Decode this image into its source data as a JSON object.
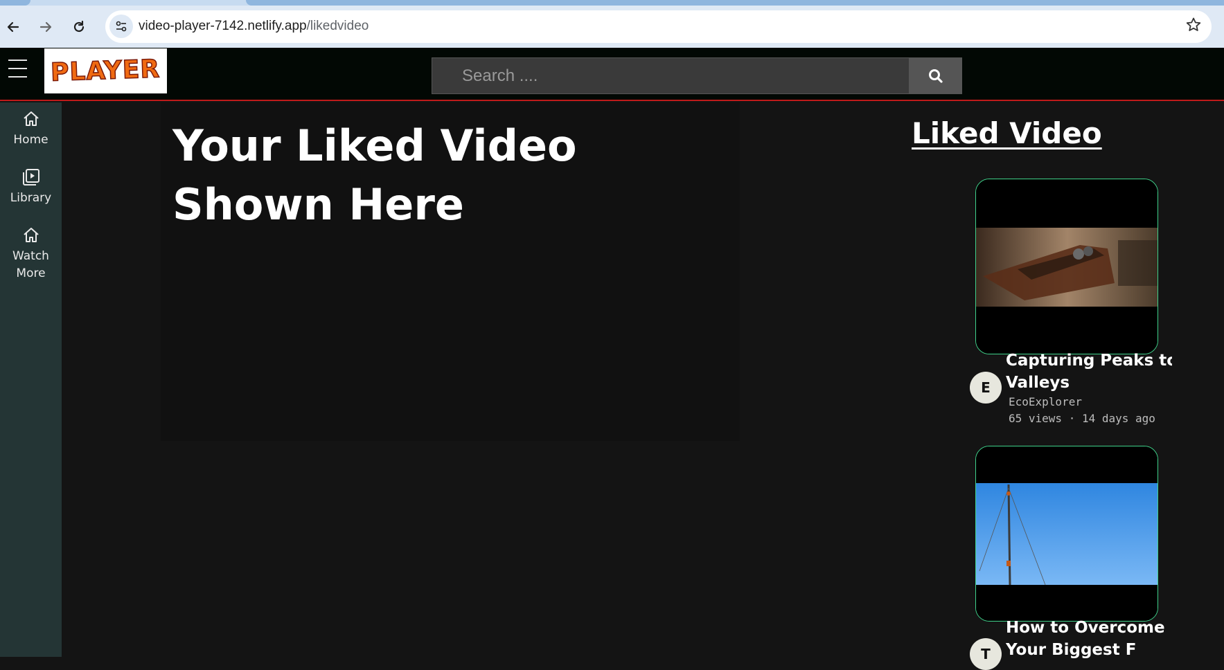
{
  "browser": {
    "url_host": "video-player-7142.netlify.app",
    "url_path": "/likedvideo",
    "back_icon": "arrow-left-icon",
    "forward_icon": "arrow-right-icon",
    "reload_icon": "reload-icon",
    "bookmark_icon": "star-icon"
  },
  "header": {
    "logo_text": "PLAYER",
    "search_placeholder": "Search ....",
    "search_icon": "search-icon"
  },
  "sidebar": {
    "items": [
      {
        "label": "Home",
        "icon": "home-icon"
      },
      {
        "label": "Library",
        "icon": "library-icon"
      },
      {
        "label": "Watch More",
        "icon": "home-icon"
      }
    ]
  },
  "main": {
    "title": "Your Liked Video Shown Here"
  },
  "liked": {
    "heading": "Liked Video",
    "cards": [
      {
        "title": "Capturing Peaks to Valleys",
        "title_line1": "Capturing Peaks to",
        "title_line2": "Valleys",
        "avatar": "E",
        "channel": "EcoExplorer",
        "views": "65 views",
        "age": "14 days ago"
      },
      {
        "title": "How to Overcome Your Biggest F",
        "title_line1": "How to Overcome",
        "title_line2": "Your Biggest F",
        "avatar": "T"
      }
    ]
  },
  "colors": {
    "header_bg": "#020804",
    "header_border": "#c01a1a",
    "sidebar_bg": "#243535",
    "card_border": "#3fd38b",
    "page_bg": "#141414"
  }
}
